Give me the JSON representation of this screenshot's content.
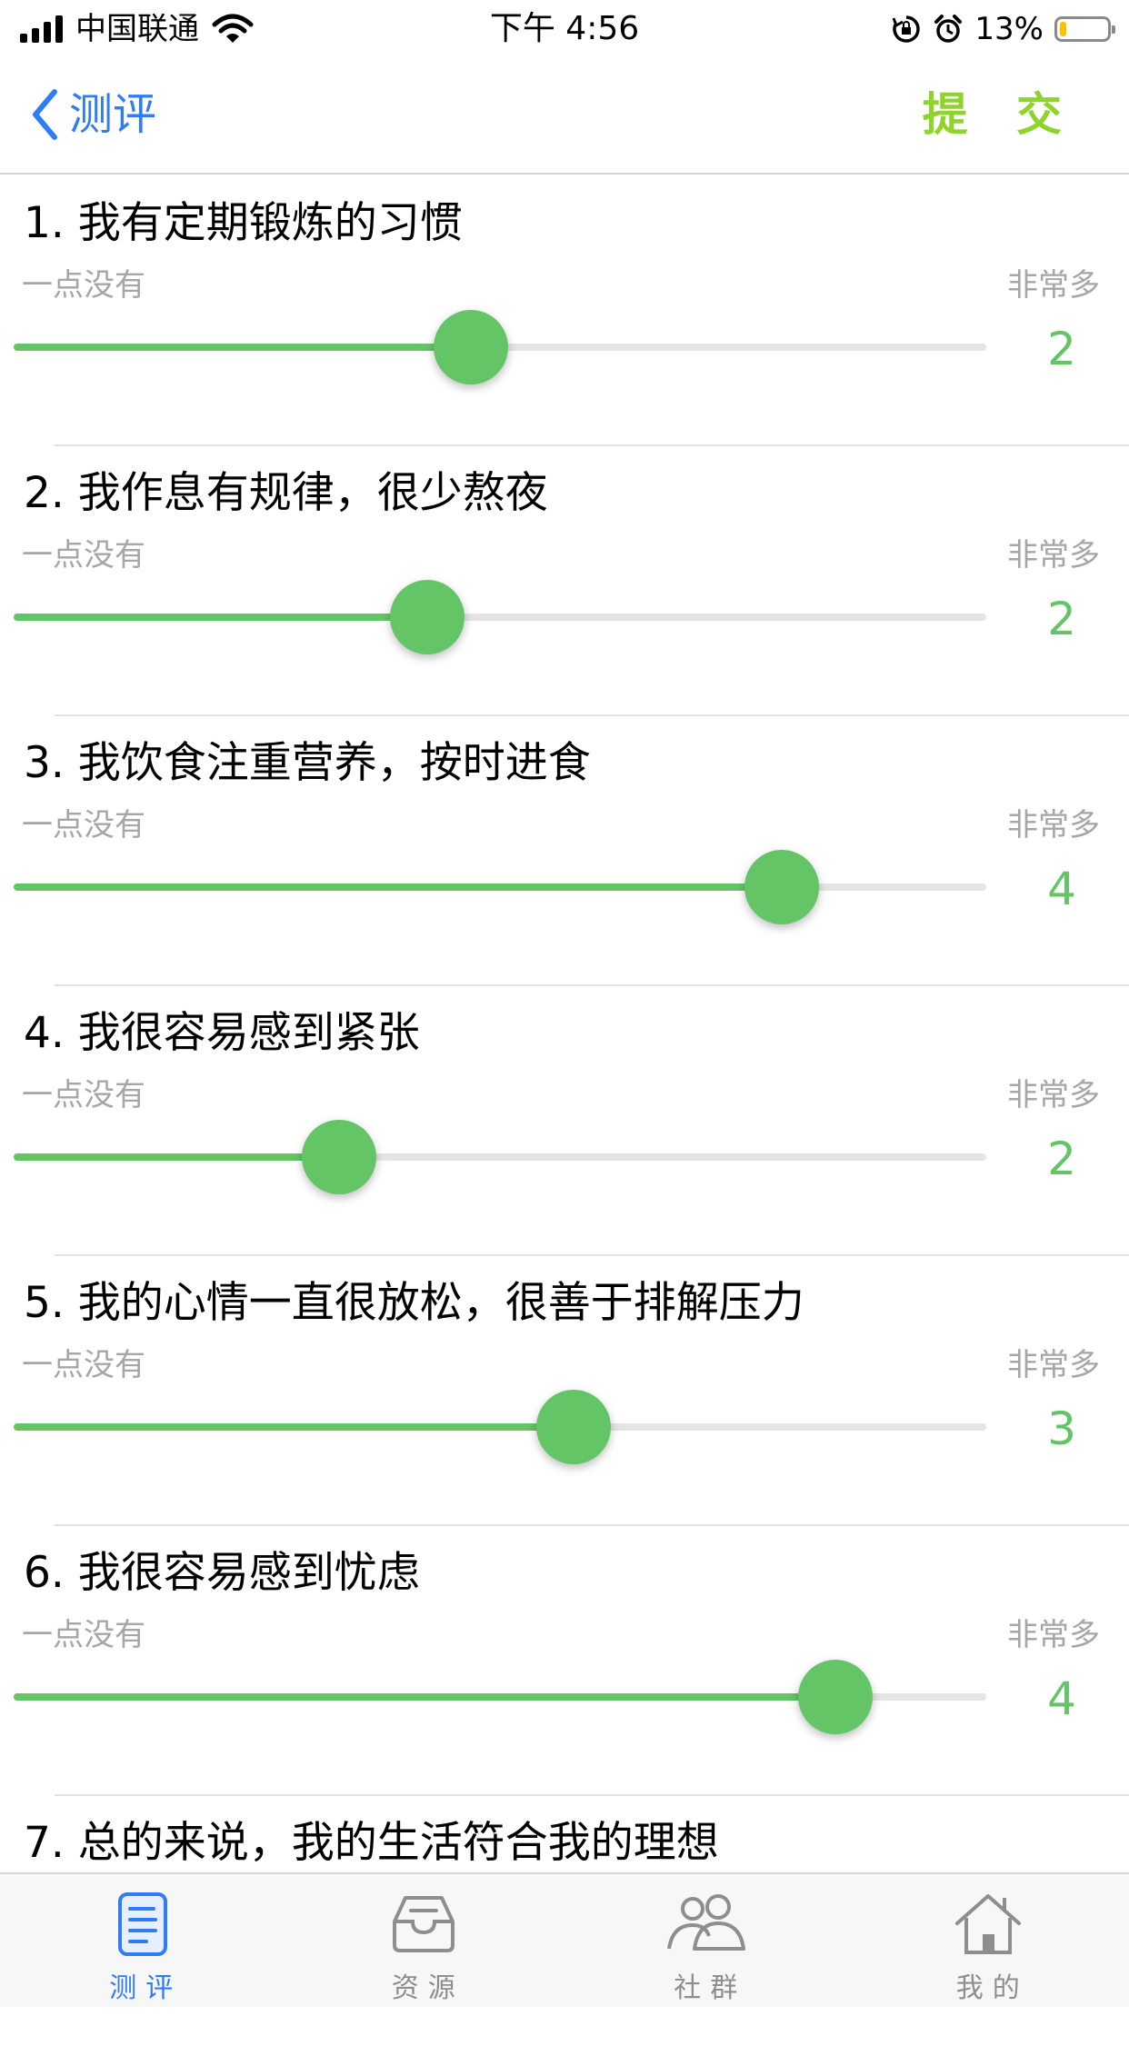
{
  "status_bar": {
    "carrier": "中国联通",
    "time": "下午 4:56",
    "battery_percent": "13%",
    "battery_level": 0.13
  },
  "nav": {
    "back_label": "测评",
    "submit_label": "提 交"
  },
  "scale": {
    "min_label": "一点没有",
    "max_label": "非常多"
  },
  "questions": [
    {
      "title": "1. 我有定期锻炼的习惯",
      "value": "2",
      "slider_fraction": 0.47
    },
    {
      "title": "2. 我作息有规律，很少熬夜",
      "value": "2",
      "slider_fraction": 0.425
    },
    {
      "title": "3. 我饮食注重营养，按时进食",
      "value": "4",
      "slider_fraction": 0.79
    },
    {
      "title": "4. 我很容易感到紧张",
      "value": "2",
      "slider_fraction": 0.335
    },
    {
      "title": "5. 我的心情一直很放松，很善于排解压力",
      "value": "3",
      "slider_fraction": 0.576
    },
    {
      "title": "6. 我很容易感到忧虑",
      "value": "4",
      "slider_fraction": 0.845
    },
    {
      "title": "7. 总的来说，我的生活符合我的理想",
      "value": "",
      "slider_fraction": null
    }
  ],
  "tabs": [
    {
      "label": "测评",
      "icon": "document-icon",
      "active": true
    },
    {
      "label": "资源",
      "icon": "inbox-icon",
      "active": false
    },
    {
      "label": "社群",
      "icon": "people-icon",
      "active": false
    },
    {
      "label": "我的",
      "icon": "home-icon",
      "active": false
    }
  ],
  "colors": {
    "accent_blue": "#2f7cf6",
    "submit_green": "#8ed42b",
    "slider_green": "#63c565",
    "muted_text": "#a6a6a6"
  }
}
